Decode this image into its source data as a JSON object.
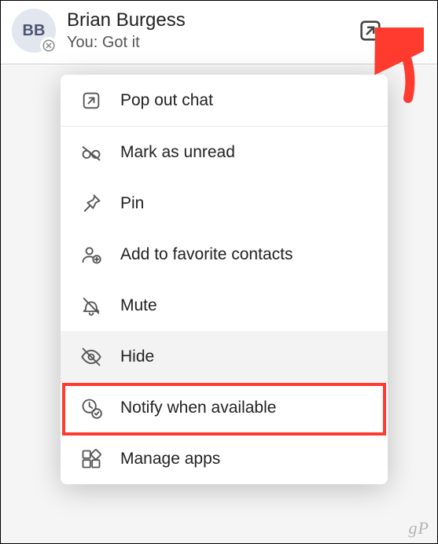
{
  "chat": {
    "avatar_initials": "BB",
    "name": "Brian Burgess",
    "preview": "You: Got it"
  },
  "menu": {
    "pop_out": "Pop out chat",
    "mark_unread": "Mark as unread",
    "pin": "Pin",
    "add_favorite": "Add to favorite contacts",
    "mute": "Mute",
    "hide": "Hide",
    "notify": "Notify when available",
    "manage_apps": "Manage apps"
  },
  "watermark": "gP"
}
